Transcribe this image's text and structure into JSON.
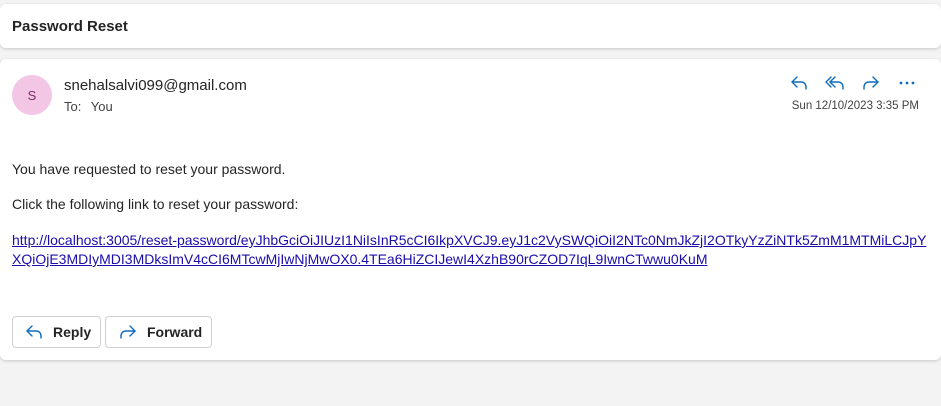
{
  "subject": "Password Reset",
  "message": {
    "avatar_initial": "S",
    "sender": "snehalsalvi099@gmail.com",
    "to_label": "To:",
    "to_value": "You",
    "timestamp": "Sun 12/10/2023 3:35 PM",
    "body_line1": "You have requested to reset your password.",
    "body_line2": "Click the following link to reset your password:",
    "link": "http://localhost:3005/reset-password/eyJhbGciOiJIUzI1NiIsInR5cCI6IkpXVCJ9.eyJ1c2VySWQiOiI2NTc0NmJkZjI2OTkyYzZiNTk5ZmM1MTMiLCJpYXQiOjE3MDIyMDI3MDksImV4cCI6MTcwMjIwNjMwOX0.4TEa6HiZCIJewI4XzhB90rCZOD7IqL9IwnCTwwu0KuM"
  },
  "buttons": {
    "reply": "Reply",
    "forward": "Forward"
  },
  "icons": {
    "reply": "reply-icon",
    "reply_all": "reply-all-icon",
    "forward": "forward-icon",
    "more": "more-icon"
  },
  "colors": {
    "accent": "#0f6cbd",
    "link": "#1a0dab",
    "avatar_bg": "#f3c6e6",
    "avatar_text": "#7b2a68"
  }
}
